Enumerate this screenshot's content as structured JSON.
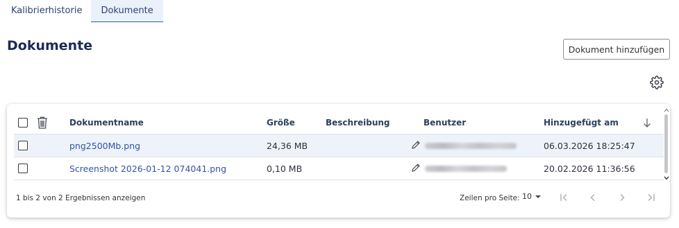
{
  "tabs": [
    {
      "label": "Kalibrierhistorie",
      "active": false
    },
    {
      "label": "Dokumente",
      "active": true
    }
  ],
  "page": {
    "title": "Dokumente",
    "add_button_label": "Dokument hinzufügen"
  },
  "icons": {
    "settings": "gear-icon",
    "delete": "trash-icon",
    "sort": "arrow-down-icon",
    "edit": "pencil-icon"
  },
  "table": {
    "columns": {
      "name": "Dokumentname",
      "size": "Größe",
      "description": "Beschreibung",
      "user": "Benutzer",
      "added": "Hinzugefügt am"
    },
    "rows": [
      {
        "name": "png2500Mb.png",
        "size": "24,36 MB",
        "description": "",
        "user": "[redacted]",
        "added": "06.03.2026 18:25:47"
      },
      {
        "name": "Screenshot 2026-01-12 074041.png",
        "size": "0,10 MB",
        "description": "",
        "user": "[redacted]",
        "added": "20.02.2026 11:36:56"
      }
    ]
  },
  "footer": {
    "info": "1 bis 2 von 2 Ergebnissen anzeigen",
    "rows_per_page_label": "Zeilen pro Seite:",
    "rows_per_page_value": "10"
  },
  "colors": {
    "accent": "#2d5fb1",
    "link": "#2f55a4",
    "title": "#1d2a55",
    "selected_row": "#eef3fa"
  }
}
